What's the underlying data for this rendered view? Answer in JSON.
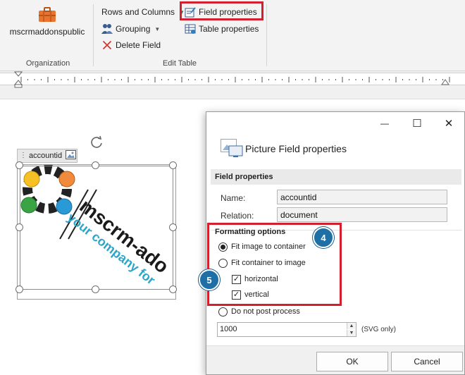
{
  "ribbon": {
    "organization": {
      "button_label": "mscrmaddonspublic",
      "group_label": "Organization",
      "icon": "briefcase-icon"
    },
    "edit_table": {
      "rows_and_columns": "Rows and Columns",
      "grouping": "Grouping",
      "delete_field": "Delete Field",
      "field_properties": "Field properties",
      "table_properties": "Table properties",
      "group_label": "Edit Table"
    }
  },
  "canvas": {
    "field_tag": "accountid",
    "logo": {
      "line1": "mscrm-ado",
      "line2": "your company for"
    }
  },
  "dialog": {
    "window_controls": {
      "minimize": "—",
      "maximize": "☐",
      "close": "✕"
    },
    "title": "Picture Field properties",
    "field_properties_header": "Field properties",
    "name_label": "Name:",
    "name_value": "accountid",
    "relation_label": "Relation:",
    "relation_value": "document",
    "formatting_header": "Formatting options",
    "options": {
      "fit_image": "Fit image to container",
      "fit_container": "Fit container to image",
      "horizontal": "horizontal",
      "vertical": "vertical",
      "do_not_post": "Do not post process"
    },
    "size_value": "1000",
    "svg_only": "(SVG only)",
    "ok": "OK",
    "cancel": "Cancel"
  },
  "callouts": {
    "a": "4",
    "b": "5"
  },
  "colors": {
    "highlight": "#d3202e",
    "callout": "#1f6fa7",
    "delete_red": "#d03a2e"
  }
}
